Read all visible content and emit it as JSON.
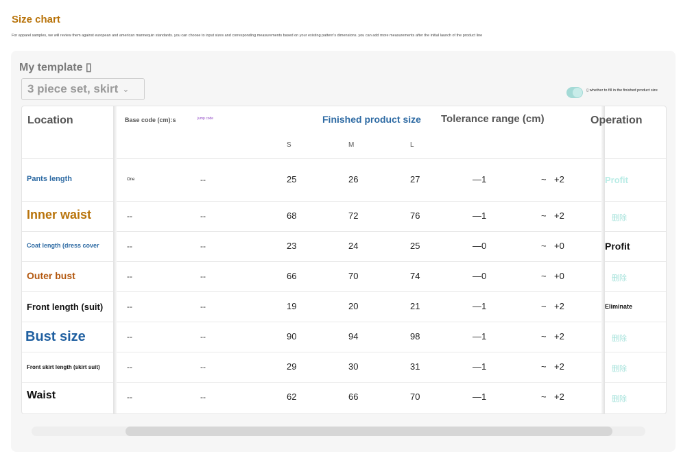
{
  "page": {
    "title": "Size chart",
    "description": "For apparel samples, we will review them against european and american mannequin standards. you can choose to input sizes and corresponding measurements based on your existing pattern's dimensions. you can add more measurements after the initial launch of the product line"
  },
  "template": {
    "label": "My template ▯",
    "selected": "3 piece set, skirt",
    "toggle_label": "▯ whether to fill in the finished product size",
    "toggle_on": true
  },
  "table": {
    "headers": {
      "location": "Location",
      "base_code": "Base code (cm):s",
      "jump_code": "jump code",
      "finished": "Finished product size",
      "tolerance": "Tolerance range (cm)",
      "operation": "Operation"
    },
    "sizes": [
      "S",
      "M",
      "L"
    ],
    "rows": [
      {
        "location": "Pants length",
        "base": "One",
        "jump": "--",
        "s": "25",
        "m": "26",
        "l": "27",
        "tol_min": "—1",
        "tilde": "~",
        "tol_max": "+2",
        "op": "Profit"
      },
      {
        "location": "Inner waist",
        "base": "--",
        "jump": "--",
        "s": "68",
        "m": "72",
        "l": "76",
        "tol_min": "—1",
        "tilde": "~",
        "tol_max": "+2",
        "op": "删除"
      },
      {
        "location": "Coat length (dress cover",
        "base": "--",
        "jump": "--",
        "s": "23",
        "m": "24",
        "l": "25",
        "tol_min": "—0",
        "tilde": "~",
        "tol_max": "+0",
        "op": "Profit"
      },
      {
        "location": "Outer bust",
        "base": "--",
        "jump": "--",
        "s": "66",
        "m": "70",
        "l": "74",
        "tol_min": "—0",
        "tilde": "~",
        "tol_max": "+0",
        "op": "删除"
      },
      {
        "location": "Front length (suit)",
        "base": "--",
        "jump": "--",
        "s": "19",
        "m": "20",
        "l": "21",
        "tol_min": "—1",
        "tilde": "~",
        "tol_max": "+2",
        "op": "Eliminate"
      },
      {
        "location": "Bust size",
        "base": "--",
        "jump": "--",
        "s": "90",
        "m": "94",
        "l": "98",
        "tol_min": "—1",
        "tilde": "~",
        "tol_max": "+2",
        "op": "删除"
      },
      {
        "location": "Front skirt length (skirt suit)",
        "base": "--",
        "jump": "--",
        "s": "29",
        "m": "30",
        "l": "31",
        "tol_min": "—1",
        "tilde": "~",
        "tol_max": "+2",
        "op": "删除"
      },
      {
        "location": "Waist",
        "base": "--",
        "jump": "--",
        "s": "62",
        "m": "66",
        "l": "70",
        "tol_min": "—1",
        "tilde": "~",
        "tol_max": "+2",
        "op": "删除"
      }
    ]
  },
  "colors": {
    "title": "#b8730a",
    "finished_header": "#2d6aa3",
    "toggle": "#a4dad6",
    "delete_link": "#a8e3dc"
  }
}
